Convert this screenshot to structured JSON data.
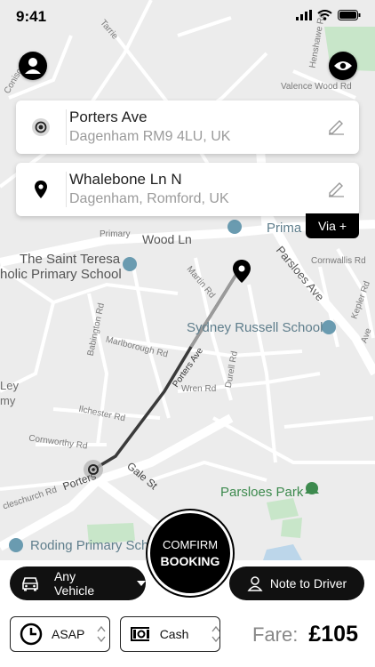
{
  "status_bar": {
    "time": "9:41"
  },
  "map": {
    "streets": [
      "Wood Ln",
      "Parsloes Ave",
      "Martin Rd",
      "Babington Rd",
      "Marlborough Rd",
      "Porters Ave",
      "Wren Rd",
      "Durell Rd",
      "Ilchester Rd",
      "Cornworthy Rd",
      "Gale St",
      "Porters",
      "Cornwallis Rd",
      "Kepler Rd",
      "Valence Wood Rd",
      "Henshawe Rd",
      "Ave",
      "Ley",
      "my",
      "cleschurch Rd",
      "Conisc",
      "Tarrie",
      "Primary"
    ],
    "places": [
      "The Saint Teresa",
      "holic Primary School",
      "Sydney Russell School",
      "Parsloes Park",
      "Roding Primary Scho",
      "Prima"
    ]
  },
  "pickup": {
    "title": "Porters Ave",
    "subtitle": "Dagenham RM9 4LU, UK"
  },
  "dropoff": {
    "title": "Whalebone Ln N",
    "subtitle": "Dagenham, Romford, UK"
  },
  "via_label": "Via +",
  "confirm": {
    "line1": "COMFIRM",
    "line2": "BOOKING"
  },
  "vehicle": {
    "label": "Any Vehicle"
  },
  "note_button": {
    "label": "Note to Driver"
  },
  "time_select": {
    "value": "ASAP"
  },
  "payment_select": {
    "value": "Cash"
  },
  "fare": {
    "label": "Fare:",
    "amount": "£105"
  },
  "colors": {
    "accent": "#000000",
    "park_green": "#c5e3c6",
    "route": "#333333",
    "poi_blue": "#5f8ea3"
  }
}
